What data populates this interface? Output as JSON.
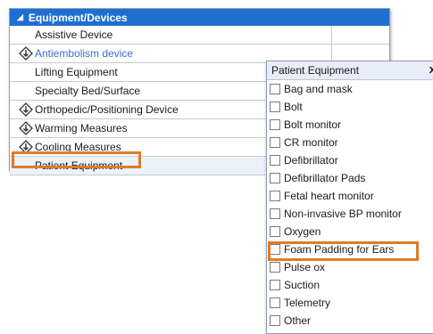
{
  "tree": {
    "header": "Equipment/Devices",
    "header_icon": "collapse-triangle-icon",
    "rows": [
      {
        "label": "Assistive Device",
        "icon": false,
        "alt": false
      },
      {
        "label": "Antiembolism device",
        "icon": true,
        "alt": true
      },
      {
        "label": "Lifting Equipment",
        "icon": false,
        "alt": false
      },
      {
        "label": "Specialty Bed/Surface",
        "icon": false,
        "alt": false
      },
      {
        "label": "Orthopedic/Positioning Device",
        "icon": true,
        "alt": false
      },
      {
        "label": "Warming Measures",
        "icon": true,
        "alt": false
      },
      {
        "label": "Cooling Measures",
        "icon": true,
        "alt": false
      },
      {
        "label": "Patient Equipment",
        "icon": false,
        "alt": false,
        "selected": true
      }
    ]
  },
  "popup": {
    "title": "Patient Equipment",
    "close": "x",
    "options": [
      "Bag and mask",
      "Bolt",
      "Bolt monitor",
      "CR monitor",
      "Defibrillator",
      "Defibrillator Pads",
      "Fetal heart monitor",
      "Non-invasive BP monitor",
      "Oxygen",
      "Foam Padding for Ears",
      "Pulse ox",
      "Suction",
      "Telemetry",
      "Other"
    ]
  },
  "colors": {
    "header_bg": "#1f6fd1",
    "highlight": "#e07b27",
    "link_text": "#3a6fd0"
  }
}
